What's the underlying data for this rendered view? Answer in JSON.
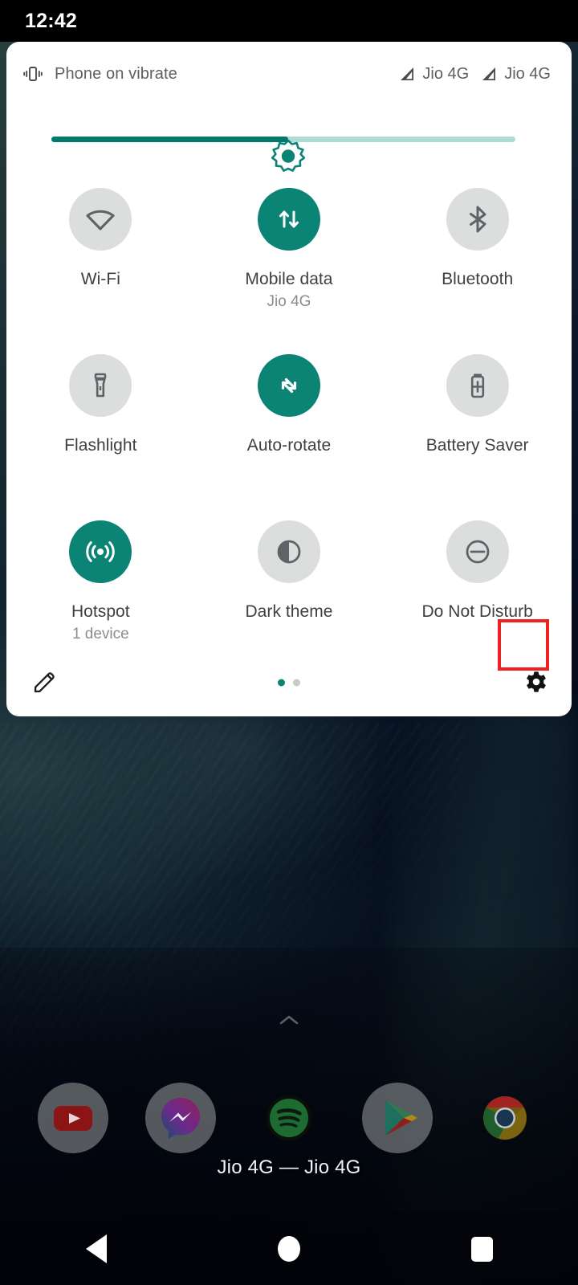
{
  "statusbar": {
    "time": "12:42"
  },
  "quick_settings": {
    "status_text": "Phone on vibrate",
    "vibrate_icon": "vibrate-icon",
    "signals": [
      {
        "icon": "signal-bars-icon",
        "label": "Jio 4G"
      },
      {
        "icon": "signal-bars-icon",
        "label": "Jio 4G"
      }
    ],
    "brightness": {
      "icon": "brightness-sun-icon",
      "value_percent": 51,
      "fill_color": "#00796b",
      "track_color": "#aedcd5"
    },
    "active_color": "#0b8476",
    "inactive_color": "#dcdedd",
    "tiles": [
      {
        "label": "Wi-Fi",
        "sub": "",
        "icon": "wifi-icon",
        "state": "off"
      },
      {
        "label": "Mobile data",
        "sub": "Jio 4G",
        "icon": "mobile-data-icon",
        "state": "on"
      },
      {
        "label": "Bluetooth",
        "sub": "",
        "icon": "bluetooth-icon",
        "state": "off"
      },
      {
        "label": "Flashlight",
        "sub": "",
        "icon": "flashlight-icon",
        "state": "off"
      },
      {
        "label": "Auto-rotate",
        "sub": "",
        "icon": "auto-rotate-icon",
        "state": "on"
      },
      {
        "label": "Battery Saver",
        "sub": "",
        "icon": "battery-saver-icon",
        "state": "off"
      },
      {
        "label": "Hotspot",
        "sub": "1 device",
        "icon": "hotspot-icon",
        "state": "on"
      },
      {
        "label": "Dark theme",
        "sub": "",
        "icon": "dark-theme-icon",
        "state": "off"
      },
      {
        "label": "Do Not Disturb",
        "sub": "",
        "icon": "do-not-disturb-icon",
        "state": "off"
      }
    ],
    "footer": {
      "edit_icon": "pencil-edit-icon",
      "settings_icon": "gear-icon",
      "pages": 2,
      "active_page": 1
    },
    "annotation": {
      "target": "settings-gear-button",
      "color": "#ee2020"
    }
  },
  "home": {
    "drawer_chevron_icon": "chevron-up-icon",
    "carrier_text": "Jio 4G — Jio 4G",
    "dock": [
      {
        "name": "YouTube",
        "icon": "youtube-icon"
      },
      {
        "name": "Messenger",
        "icon": "messenger-icon"
      },
      {
        "name": "Spotify",
        "icon": "spotify-icon"
      },
      {
        "name": "Play Store",
        "icon": "play-store-icon"
      },
      {
        "name": "Chrome",
        "icon": "chrome-icon"
      }
    ]
  },
  "navbar": {
    "buttons": [
      {
        "name": "back",
        "icon": "back-triangle-icon"
      },
      {
        "name": "home",
        "icon": "home-circle-icon"
      },
      {
        "name": "recents",
        "icon": "recents-square-icon"
      }
    ]
  }
}
